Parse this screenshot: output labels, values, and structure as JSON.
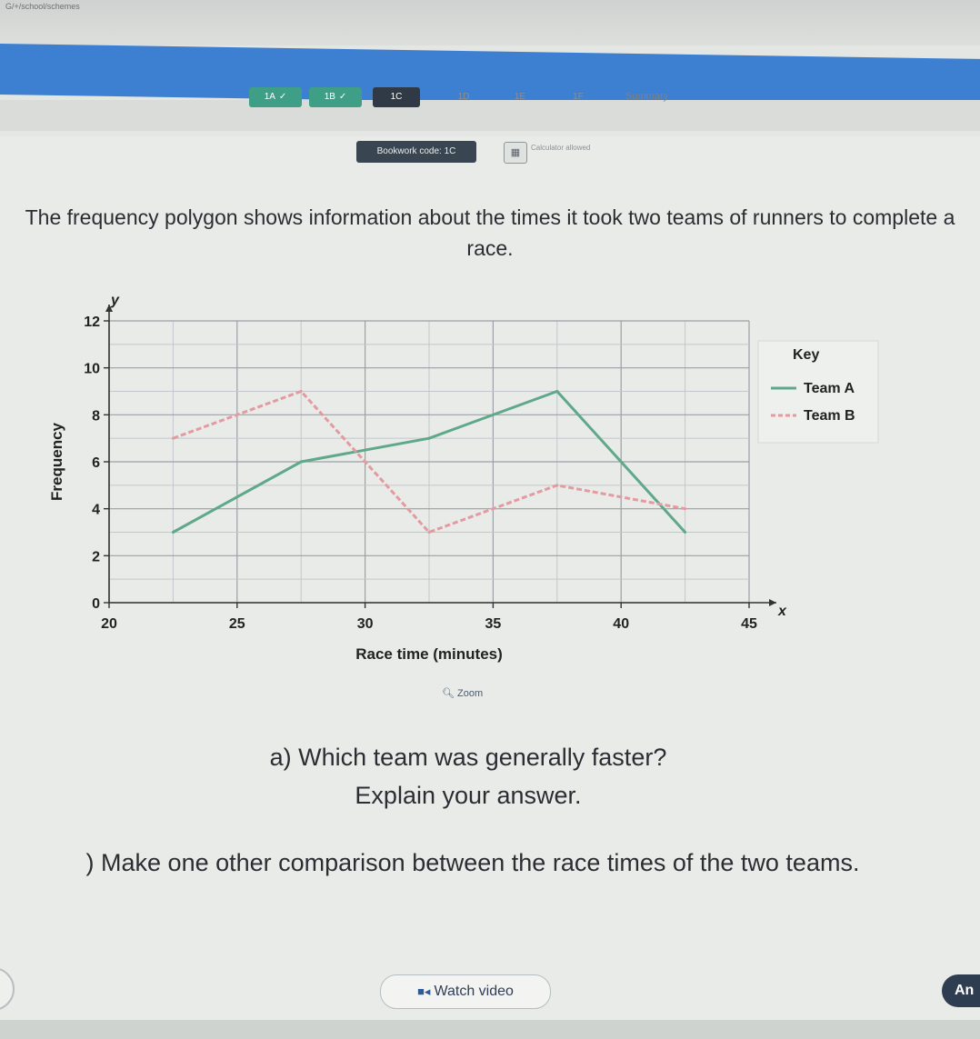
{
  "browser": {
    "url_text": "G/+/school/schemes"
  },
  "tabs": [
    {
      "label": "1A",
      "state": "done"
    },
    {
      "label": "1B",
      "state": "done"
    },
    {
      "label": "1C",
      "state": "current"
    },
    {
      "label": "1D",
      "state": "todo"
    },
    {
      "label": "1E",
      "state": "todo"
    },
    {
      "label": "1F",
      "state": "todo"
    }
  ],
  "tabs_summary": "Summary",
  "bookwork": {
    "label": "Bookwork code: 1C"
  },
  "calculator": {
    "note": "Calculator allowed"
  },
  "question": {
    "intro": "The frequency polygon shows information about the times it took two teams of runners to complete a race.",
    "part_a_line1": "a) Which team was generally faster?",
    "part_a_line2": "Explain your answer.",
    "part_b": ") Make one other comparison between the race times of the two teams."
  },
  "zoom_label": "Zoom",
  "buttons": {
    "watch_video": "Watch video",
    "answer": "An"
  },
  "colors": {
    "team_a": "#5fa88a",
    "team_b": "#e39aa0",
    "nav_blue": "#3d7fd0",
    "tab_done": "#3f9e86",
    "tab_current": "#2f3a46"
  },
  "chart_data": {
    "type": "line",
    "xlabel": "Race time (minutes)",
    "ylabel": "Frequency",
    "x_axis_symbol": "x",
    "y_axis_symbol": "y",
    "xlim": [
      20,
      45
    ],
    "ylim": [
      0,
      12
    ],
    "x_ticks": [
      20,
      25,
      30,
      35,
      40,
      45
    ],
    "y_ticks": [
      0,
      2,
      4,
      6,
      8,
      10,
      12
    ],
    "grid": true,
    "legend": {
      "title": "Key",
      "position": "right"
    },
    "series": [
      {
        "name": "Team A",
        "style": "solid",
        "x": [
          22.5,
          27.5,
          32.5,
          37.5,
          42.5
        ],
        "y": [
          3,
          6,
          7,
          9,
          3
        ]
      },
      {
        "name": "Team B",
        "style": "dashed",
        "x": [
          22.5,
          27.5,
          32.5,
          37.5,
          42.5
        ],
        "y": [
          7,
          9,
          3,
          5,
          4
        ]
      }
    ]
  }
}
